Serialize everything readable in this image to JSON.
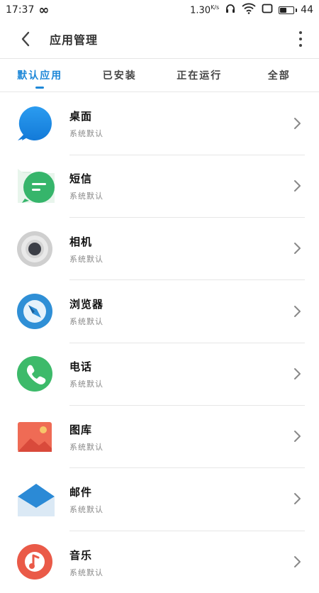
{
  "status": {
    "time": "17:37",
    "speed": "1.30",
    "speed_unit": "K/s",
    "battery": "44",
    "battery_level": 0.44
  },
  "header": {
    "title": "应用管理"
  },
  "tabs": [
    {
      "label": "默认应用",
      "active": true
    },
    {
      "label": "已安装"
    },
    {
      "label": "正在运行"
    },
    {
      "label": "全部"
    }
  ],
  "apps": [
    {
      "name": "桌面",
      "sub": "系统默认",
      "icon": "home-app-icon"
    },
    {
      "name": "短信",
      "sub": "系统默认",
      "icon": "messages-app-icon"
    },
    {
      "name": "相机",
      "sub": "系统默认",
      "icon": "camera-app-icon"
    },
    {
      "name": "浏览器",
      "sub": "系统默认",
      "icon": "browser-app-icon"
    },
    {
      "name": "电话",
      "sub": "系统默认",
      "icon": "phone-app-icon"
    },
    {
      "name": "图库",
      "sub": "系统默认",
      "icon": "gallery-app-icon"
    },
    {
      "name": "邮件",
      "sub": "系统默认",
      "icon": "mail-app-icon"
    },
    {
      "name": "音乐",
      "sub": "系统默认",
      "icon": "music-app-icon"
    }
  ],
  "colors": {
    "accent": "#1e88d8"
  }
}
